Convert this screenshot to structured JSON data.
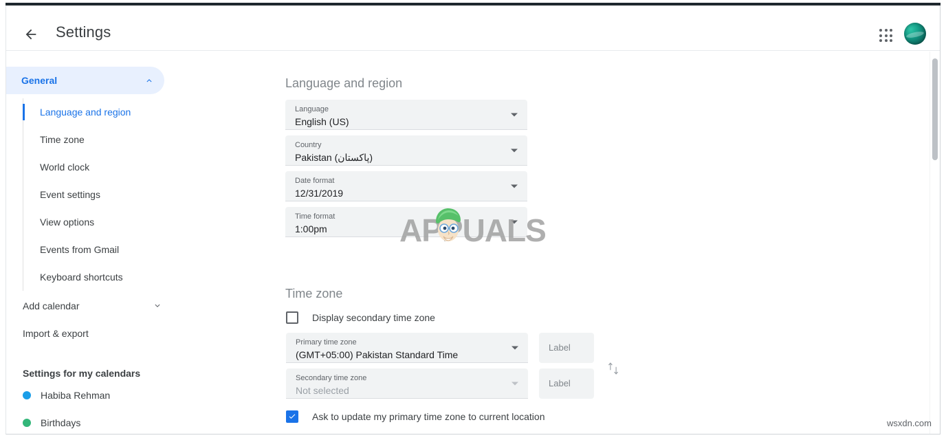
{
  "window": {
    "title": "Settings"
  },
  "header": {
    "back_icon": "arrow-left-icon",
    "title": "Settings",
    "apps_icon": "apps-grid-icon",
    "avatar_icon": "user-avatar"
  },
  "sidebar": {
    "section": {
      "label": "General",
      "expanded": true,
      "chevron_icon": "chevron-up-icon",
      "items": [
        {
          "label": "Language and region",
          "active": true
        },
        {
          "label": "Time zone",
          "active": false
        },
        {
          "label": "World clock",
          "active": false
        },
        {
          "label": "Event settings",
          "active": false
        },
        {
          "label": "View options",
          "active": false
        },
        {
          "label": "Events from Gmail",
          "active": false
        },
        {
          "label": "Keyboard shortcuts",
          "active": false
        }
      ]
    },
    "rows": [
      {
        "label": "Add calendar",
        "chevron_icon": "chevron-down-icon",
        "has_chevron": true
      },
      {
        "label": "Import & export",
        "has_chevron": false
      }
    ],
    "calendars_heading": "Settings for my calendars",
    "calendars": [
      {
        "label": "Habiba Rehman",
        "color": "#1a9ee8"
      },
      {
        "label": "Birthdays",
        "color": "#33b679"
      }
    ]
  },
  "main": {
    "language_region": {
      "title": "Language and region",
      "fields": [
        {
          "label": "Language",
          "value": "English (US)",
          "arrow": "dropdown-arrow-icon",
          "dim": false
        },
        {
          "label": "Country",
          "value": "Pakistan (پاکستان)",
          "arrow": "dropdown-arrow-icon",
          "dim": false
        },
        {
          "label": "Date format",
          "value": "12/31/2019",
          "arrow": "dropdown-arrow-icon",
          "dim": false
        },
        {
          "label": "Time format",
          "value": "1:00pm",
          "arrow": "dropdown-arrow-icon",
          "dim": false
        }
      ]
    },
    "time_zone": {
      "title": "Time zone",
      "display_secondary": {
        "label": "Display secondary time zone",
        "checked": false
      },
      "primary": {
        "label": "Primary time zone",
        "value": "(GMT+05:00) Pakistan Standard Time",
        "dim": false
      },
      "secondary": {
        "label": "Secondary time zone",
        "value": "Not selected",
        "dim": true
      },
      "label_primary_placeholder": "Label",
      "label_secondary_placeholder": "Label",
      "swap_icon": "swap-vertical-icon",
      "ask_update": {
        "label": "Ask to update my primary time zone to current location",
        "checked": true
      }
    }
  },
  "scrollbar": {
    "thumb_position": "top"
  },
  "watermarks": {
    "logo_text": "APPUALS",
    "bottom_right": "wsxdn.com"
  },
  "colors": {
    "accent": "#1a73e8",
    "accent_bg": "#e8f0fe",
    "field_bg": "#f1f3f4",
    "text_primary": "#202124",
    "text_secondary": "#5f6368",
    "text_muted": "#80868b"
  }
}
